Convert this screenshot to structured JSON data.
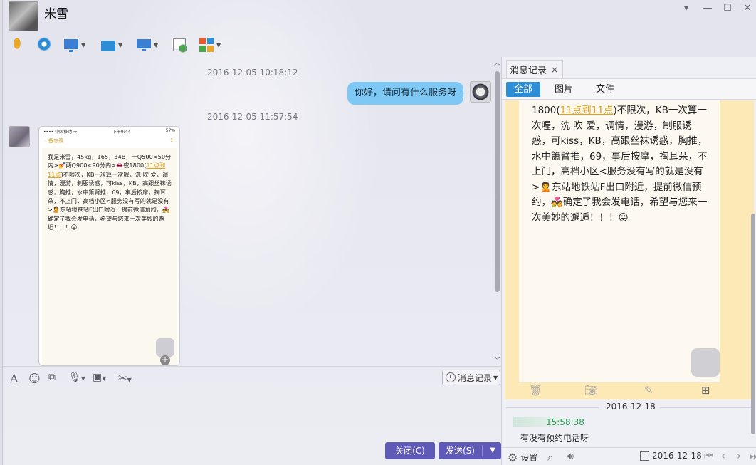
{
  "window": {
    "contact_name": "米雪",
    "controls": {
      "dropdown": "▾",
      "minimize": "—",
      "maximize": "☐",
      "close": "✕"
    }
  },
  "toolbar": {
    "items": [
      {
        "name": "voice-call-icon",
        "color": "#e8a526"
      },
      {
        "name": "video-call-icon",
        "color": "#2d8ed6"
      },
      {
        "name": "screen-share-icon",
        "color": "#3b7fd4"
      },
      {
        "name": "file-transfer-icon",
        "color": "#2d8ed6"
      },
      {
        "name": "remote-desktop-icon",
        "color": "#3b7fd4"
      },
      {
        "name": "new-chat-icon",
        "color": "#48a848"
      },
      {
        "name": "apps-icon",
        "color": "#e65c2e"
      }
    ]
  },
  "chat": {
    "timestamp_1": "2016-12-05 10:18:12",
    "outgoing_message": "你好，请问有什么服务呀",
    "timestamp_2": "2016-12-05 11:57:54",
    "phone_screenshot": {
      "status_left": "•••• 中国移动 ᯤ",
      "status_time": "下午9:44",
      "status_right": "57%",
      "back_label": "‹ 备忘录",
      "text_before": "我是米雪，45kg，165，34B，一Q500<50分内>💅两Q900<90分内>👄夜1800(",
      "highlight": "11点到11点",
      "text_after": ")不限次，KB一次算一次喔，洗 吹 爱，调情，漫游，制服诱惑，可kiss，KB，高跟丝袜诱惑，胸推，水中箫臂推，69，事后按摩，掏耳朵，不上门，高档小区<服务没有写的就是没有>🙎东站地铁站F出口附近，提前微信预约，💑确定了我会发电话，希望与您来一次美妙的邂逅！！！😛"
    }
  },
  "input_toolbar": {
    "font_icon": "A",
    "emoji_icon": "☺",
    "history_label": "消息记录"
  },
  "buttons": {
    "close": "关闭(C)",
    "send": "发送(S)"
  },
  "history_panel": {
    "tab_label": "消息记录",
    "tab_close": "×",
    "filters": [
      "全部",
      "图片",
      "文件"
    ],
    "active_filter": "全部",
    "image_text_before": "1800(",
    "image_highlight": "11点到11点",
    "image_text_after": ")不限次，KB一次算一次喔，洗 吹 爱，调情，漫游，制服诱惑，可kiss，KB，高跟丝袜诱惑，胸推， 水中箫臂推，69，事后按摩，掏耳朵，不上门，高档小区<服务没有写的就是没有>🙎东站地铁站F出口附近，提前微信预约，💑确定了我会发电话，希望与您来一次美妙的邂逅！！！😛",
    "date_separator": "2016-12-18",
    "message_time": "15:58:38",
    "message_text": "有没有预约电话呀",
    "settings_label": "设置",
    "date_picker": "2016-12-18"
  }
}
